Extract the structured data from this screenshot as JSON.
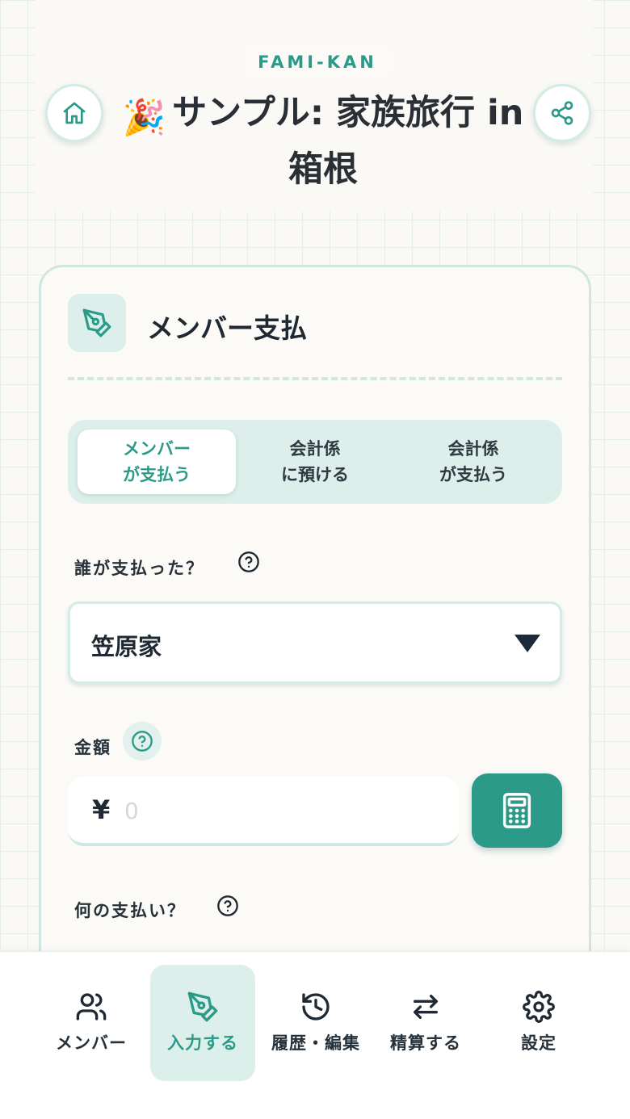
{
  "header": {
    "brand": "FAMI-KAN",
    "title": "サンプル: 家族旅行 in 箱根",
    "title_emoji": "🎉",
    "home_icon": "home-icon",
    "share_icon": "share-icon"
  },
  "card": {
    "title": "メンバー支払",
    "icon": "pen-icon",
    "segments": [
      {
        "label": "メンバー\nが支払う",
        "active": true
      },
      {
        "label": "会計係\nに預ける",
        "active": false
      },
      {
        "label": "会計係\nが支払う",
        "active": false
      }
    ],
    "payer": {
      "label": "誰が支払った？",
      "value": "笠原家"
    },
    "amount": {
      "label": "金額",
      "currency": "¥",
      "placeholder": "0"
    },
    "purpose": {
      "label": "何の支払い？"
    }
  },
  "nav": {
    "items": [
      {
        "label": "メンバー",
        "icon": "users-icon",
        "active": false
      },
      {
        "label": "入力する",
        "icon": "pen-icon",
        "active": true
      },
      {
        "label": "履歴・編集",
        "icon": "history-icon",
        "active": false
      },
      {
        "label": "精算する",
        "icon": "transfer-icon",
        "active": false
      },
      {
        "label": "設定",
        "icon": "gear-icon",
        "active": false
      }
    ]
  },
  "colors": {
    "accent": "#2b9a88",
    "accent_light": "#dcefeb",
    "text": "#1f2933"
  }
}
